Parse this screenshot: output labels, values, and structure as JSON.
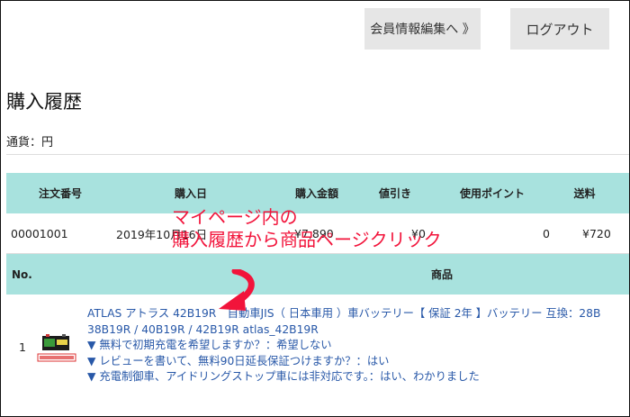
{
  "header": {
    "edit_member_button": "会員情報編集へ 》",
    "logout_button": "ログアウト"
  },
  "page": {
    "title": "購入履歴",
    "currency_label": "通貨：円"
  },
  "order_table": {
    "columns": [
      "注文番号",
      "購入日",
      "購入金額",
      "値引き",
      "使用ポイント",
      "送料"
    ],
    "row": {
      "order_number": "00001001",
      "purchase_date": "2019年10月16日",
      "amount": "¥7,890",
      "discount": "¥0",
      "points_used": "0",
      "shipping": "¥720"
    }
  },
  "items_table": {
    "columns": [
      "No.",
      "商品"
    ],
    "item": {
      "no": "1",
      "name_line1": "ATLAS アトラス 42B19R　自動車JIS（ 日本車用 ）車バッテリー【 保証 2年 】バッテリー 互換：28B",
      "name_line2": "38B19R / 40B19R / 42B19R atlas_42B19R",
      "option1": "▼ 無料で初期充電を希望しますか？：希望しない",
      "option2": "▼ レビューを書いて、無料90日延長保証つけますか？：はい",
      "option3": "▼ 充電制御車、アイドリングストップ車には非対応です。：はい、わかりました"
    }
  },
  "annotation": {
    "line1": "マイページ内の",
    "line2": "購入履歴から商品ページクリック",
    "color": "#f2143b"
  }
}
